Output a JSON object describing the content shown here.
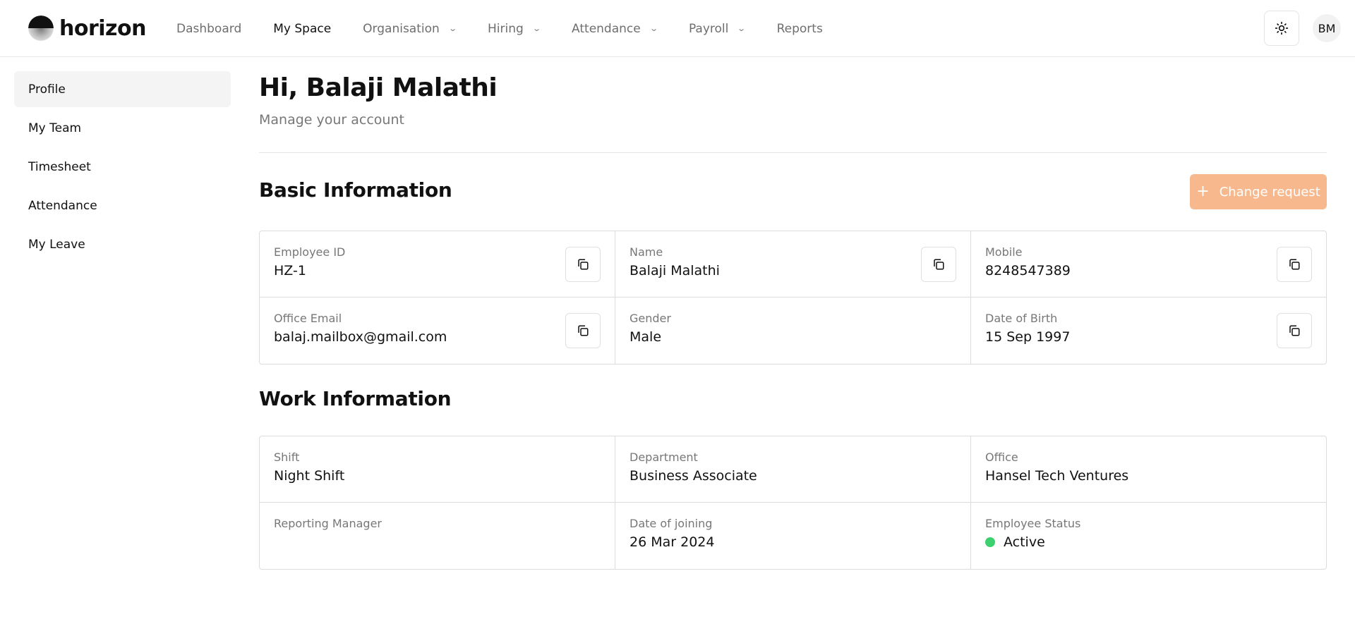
{
  "app": {
    "brand": "horizon"
  },
  "nav": {
    "items": [
      {
        "label": "Dashboard",
        "dropdown": false,
        "active": false
      },
      {
        "label": "My Space",
        "dropdown": false,
        "active": true
      },
      {
        "label": "Organisation",
        "dropdown": true,
        "active": false
      },
      {
        "label": "Hiring",
        "dropdown": true,
        "active": false
      },
      {
        "label": "Attendance",
        "dropdown": true,
        "active": false
      },
      {
        "label": "Payroll",
        "dropdown": true,
        "active": false
      },
      {
        "label": "Reports",
        "dropdown": false,
        "active": false
      }
    ]
  },
  "user": {
    "initials": "BM"
  },
  "sidebar": {
    "items": [
      {
        "label": "Profile",
        "active": true
      },
      {
        "label": "My Team",
        "active": false
      },
      {
        "label": "Timesheet",
        "active": false
      },
      {
        "label": "Attendance",
        "active": false
      },
      {
        "label": "My Leave",
        "active": false
      }
    ]
  },
  "header": {
    "greeting": "Hi, Balaji Malathi",
    "subtitle": "Manage your account"
  },
  "basic": {
    "title": "Basic Information",
    "change_request_label": "Change request",
    "fields": [
      {
        "label": "Employee ID",
        "value": "HZ-1",
        "copyable": true
      },
      {
        "label": "Name",
        "value": "Balaji Malathi",
        "copyable": true
      },
      {
        "label": "Mobile",
        "value": "8248547389",
        "copyable": true
      },
      {
        "label": "Office Email",
        "value": "balaj.mailbox@gmail.com",
        "copyable": true
      },
      {
        "label": "Gender",
        "value": "Male",
        "copyable": false
      },
      {
        "label": "Date of Birth",
        "value": "15 Sep 1997",
        "copyable": true
      }
    ]
  },
  "work": {
    "title": "Work Information",
    "fields": [
      {
        "label": "Shift",
        "value": "Night Shift"
      },
      {
        "label": "Department",
        "value": "Business Associate"
      },
      {
        "label": "Office",
        "value": "Hansel Tech Ventures"
      },
      {
        "label": "Reporting Manager",
        "value": ""
      },
      {
        "label": "Date of joining",
        "value": "26 Mar 2024"
      },
      {
        "label": "Employee Status",
        "value": "Active",
        "status_color": "#3ecf6e"
      }
    ]
  },
  "colors": {
    "accent": "#f8b88d",
    "status_active": "#3ecf6e"
  },
  "icons": {
    "theme": "sun-icon",
    "copy": "copy-icon",
    "chevron": "chevron-down-icon",
    "plus": "plus-icon"
  }
}
